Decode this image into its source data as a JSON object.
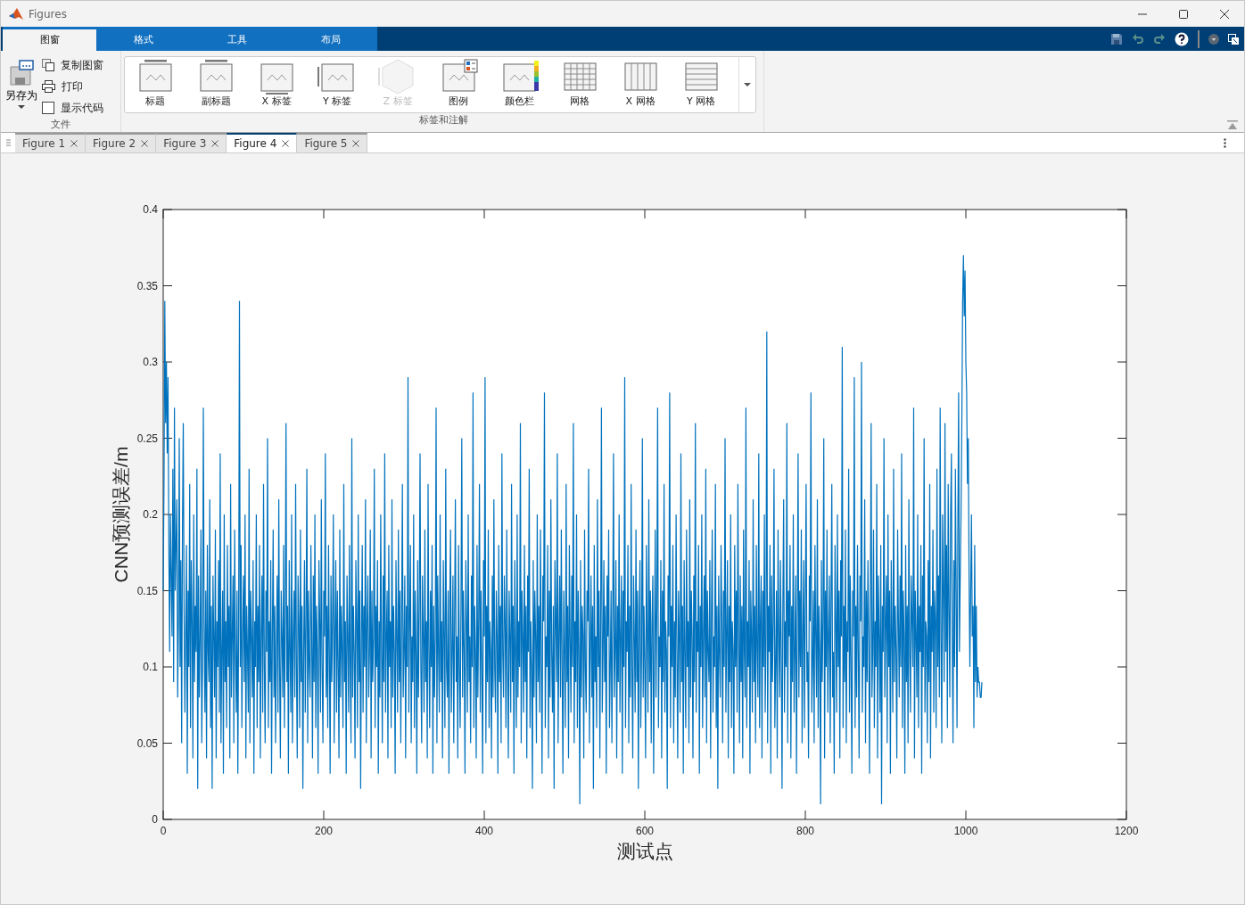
{
  "window": {
    "title": "Figures"
  },
  "ribbon_tabs": [
    {
      "label": "图窗",
      "selected": true
    },
    {
      "label": "格式",
      "selected": false
    },
    {
      "label": "工具",
      "selected": false
    },
    {
      "label": "布局",
      "selected": false
    }
  ],
  "file_section": {
    "label": "文件",
    "save_as": "另存为",
    "copy": "复制图窗",
    "print": "打印",
    "show_code": {
      "label": "显示代码",
      "checked": false
    }
  },
  "annotations_section": {
    "label": "标签和注解",
    "items": [
      {
        "kind": "title",
        "label": "标题",
        "disabled": false
      },
      {
        "kind": "subtitle",
        "label": "副标题",
        "disabled": false
      },
      {
        "kind": "xlabel",
        "label": "X 标签",
        "disabled": false
      },
      {
        "kind": "ylabel",
        "label": "Y 标签",
        "disabled": false
      },
      {
        "kind": "zlabel",
        "label": "Z 标签",
        "disabled": true
      },
      {
        "kind": "legend",
        "label": "图例",
        "disabled": false
      },
      {
        "kind": "colorbar",
        "label": "颜色栏",
        "disabled": false
      },
      {
        "kind": "grid",
        "label": "网格",
        "disabled": false
      },
      {
        "kind": "xgrid",
        "label": "X 网格",
        "disabled": false
      },
      {
        "kind": "ygrid",
        "label": "Y 网格",
        "disabled": false
      }
    ]
  },
  "figure_tabs": [
    {
      "label": "Figure 1",
      "selected": false
    },
    {
      "label": "Figure 2",
      "selected": false
    },
    {
      "label": "Figure 3",
      "selected": false
    },
    {
      "label": "Figure 4",
      "selected": true
    },
    {
      "label": "Figure 5",
      "selected": false
    }
  ],
  "plot": {
    "chart_data": {
      "type": "line",
      "xlabel": "测试点",
      "ylabel": "CNN预测误差/m",
      "xlim": [
        0,
        1200
      ],
      "ylim": [
        0,
        0.4
      ],
      "xticks": [
        0,
        200,
        400,
        600,
        800,
        1000,
        1200
      ],
      "yticks": [
        0,
        0.05,
        0.1,
        0.15,
        0.2,
        0.25,
        0.3,
        0.35,
        0.4
      ],
      "x": [
        0,
        1,
        2,
        3,
        4,
        5,
        6,
        7,
        8,
        9,
        10,
        11,
        12,
        13,
        14,
        15,
        16,
        17,
        18,
        19,
        20,
        21,
        22,
        23,
        24,
        25,
        26,
        27,
        28,
        29,
        30,
        31,
        32,
        33,
        34,
        35,
        36,
        37,
        38,
        39,
        40,
        41,
        42,
        43,
        44,
        45,
        46,
        47,
        48,
        49,
        50,
        51,
        52,
        53,
        54,
        55,
        56,
        57,
        58,
        59,
        60,
        61,
        62,
        63,
        64,
        65,
        66,
        67,
        68,
        69,
        70,
        71,
        72,
        73,
        74,
        75,
        76,
        77,
        78,
        79,
        80,
        81,
        82,
        83,
        84,
        85,
        86,
        87,
        88,
        89,
        90,
        91,
        92,
        93,
        94,
        95,
        96,
        97,
        98,
        99,
        100,
        101,
        102,
        103,
        104,
        105,
        106,
        107,
        108,
        109,
        110,
        111,
        112,
        113,
        114,
        115,
        116,
        117,
        118,
        119,
        120,
        121,
        122,
        123,
        124,
        125,
        126,
        127,
        128,
        129,
        130,
        131,
        132,
        133,
        134,
        135,
        136,
        137,
        138,
        139,
        140,
        141,
        142,
        143,
        144,
        145,
        146,
        147,
        148,
        149,
        150,
        151,
        152,
        153,
        154,
        155,
        156,
        157,
        158,
        159,
        160,
        161,
        162,
        163,
        164,
        165,
        166,
        167,
        168,
        169,
        170,
        171,
        172,
        173,
        174,
        175,
        176,
        177,
        178,
        179,
        180,
        181,
        182,
        183,
        184,
        185,
        186,
        187,
        188,
        189,
        190,
        191,
        192,
        193,
        194,
        195,
        196,
        197,
        198,
        199,
        200,
        201,
        202,
        203,
        204,
        205,
        206,
        207,
        208,
        209,
        210,
        211,
        212,
        213,
        214,
        215,
        216,
        217,
        218,
        219,
        220,
        221,
        222,
        223,
        224,
        225,
        226,
        227,
        228,
        229,
        230,
        231,
        232,
        233,
        234,
        235,
        236,
        237,
        238,
        239,
        240,
        241,
        242,
        243,
        244,
        245,
        246,
        247,
        248,
        249,
        250,
        251,
        252,
        253,
        254,
        255,
        256,
        257,
        258,
        259,
        260,
        261,
        262,
        263,
        264,
        265,
        266,
        267,
        268,
        269,
        270,
        271,
        272,
        273,
        274,
        275,
        276,
        277,
        278,
        279,
        280,
        281,
        282,
        283,
        284,
        285,
        286,
        287,
        288,
        289,
        290,
        291,
        292,
        293,
        294,
        295,
        296,
        297,
        298,
        299,
        300,
        301,
        302,
        303,
        304,
        305,
        306,
        307,
        308,
        309,
        310,
        311,
        312,
        313,
        314,
        315,
        316,
        317,
        318,
        319,
        320,
        321,
        322,
        323,
        324,
        325,
        326,
        327,
        328,
        329,
        330,
        331,
        332,
        333,
        334,
        335,
        336,
        337,
        338,
        339,
        340,
        341,
        342,
        343,
        344,
        345,
        346,
        347,
        348,
        349,
        350,
        351,
        352,
        353,
        354,
        355,
        356,
        357,
        358,
        359,
        360,
        361,
        362,
        363,
        364,
        365,
        366,
        367,
        368,
        369,
        370,
        371,
        372,
        373,
        374,
        375,
        376,
        377,
        378,
        379,
        380,
        381,
        382,
        383,
        384,
        385,
        386,
        387,
        388,
        389,
        390,
        391,
        392,
        393,
        394,
        395,
        396,
        397,
        398,
        399,
        400,
        401,
        402,
        403,
        404,
        405,
        406,
        407,
        408,
        409,
        410,
        411,
        412,
        413,
        414,
        415,
        416,
        417,
        418,
        419,
        420,
        421,
        422,
        423,
        424,
        425,
        426,
        427,
        428,
        429,
        430,
        431,
        432,
        433,
        434,
        435,
        436,
        437,
        438,
        439,
        440,
        441,
        442,
        443,
        444,
        445,
        446,
        447,
        448,
        449,
        450,
        451,
        452,
        453,
        454,
        455,
        456,
        457,
        458,
        459,
        460,
        461,
        462,
        463,
        464,
        465,
        466,
        467,
        468,
        469,
        470,
        471,
        472,
        473,
        474,
        475,
        476,
        477,
        478,
        479,
        480,
        481,
        482,
        483,
        484,
        485,
        486,
        487,
        488,
        489,
        490,
        491,
        492,
        493,
        494,
        495,
        496,
        497,
        498,
        499,
        500,
        501,
        502,
        503,
        504,
        505,
        506,
        507,
        508,
        509,
        510,
        511,
        512,
        513,
        514,
        515,
        516,
        517,
        518,
        519,
        520,
        521,
        522,
        523,
        524,
        525,
        526,
        527,
        528,
        529,
        530,
        531,
        532,
        533,
        534,
        535,
        536,
        537,
        538,
        539,
        540,
        541,
        542,
        543,
        544,
        545,
        546,
        547,
        548,
        549,
        550,
        551,
        552,
        553,
        554,
        555,
        556,
        557,
        558,
        559,
        560,
        561,
        562,
        563,
        564,
        565,
        566,
        567,
        568,
        569,
        570,
        571,
        572,
        573,
        574,
        575,
        576,
        577,
        578,
        579,
        580,
        581,
        582,
        583,
        584,
        585,
        586,
        587,
        588,
        589,
        590,
        591,
        592,
        593,
        594,
        595,
        596,
        597,
        598,
        599,
        600,
        601,
        602,
        603,
        604,
        605,
        606,
        607,
        608,
        609,
        610,
        611,
        612,
        613,
        614,
        615,
        616,
        617,
        618,
        619,
        620,
        621,
        622,
        623,
        624,
        625,
        626,
        627,
        628,
        629,
        630,
        631,
        632,
        633,
        634,
        635,
        636,
        637,
        638,
        639,
        640,
        641,
        642,
        643,
        644,
        645,
        646,
        647,
        648,
        649,
        650,
        651,
        652,
        653,
        654,
        655,
        656,
        657,
        658,
        659,
        660,
        661,
        662,
        663,
        664,
        665,
        666,
        667,
        668,
        669,
        670,
        671,
        672,
        673,
        674,
        675,
        676,
        677,
        678,
        679,
        680,
        681,
        682,
        683,
        684,
        685,
        686,
        687,
        688,
        689,
        690,
        691,
        692,
        693,
        694,
        695,
        696,
        697,
        698,
        699,
        700,
        701,
        702,
        703,
        704,
        705,
        706,
        707,
        708,
        709,
        710,
        711,
        712,
        713,
        714,
        715,
        716,
        717,
        718,
        719,
        720,
        721,
        722,
        723,
        724,
        725,
        726,
        727,
        728,
        729,
        730,
        731,
        732,
        733,
        734,
        735,
        736,
        737,
        738,
        739,
        740,
        741,
        742,
        743,
        744,
        745,
        746,
        747,
        748,
        749,
        750,
        751,
        752,
        753,
        754,
        755,
        756,
        757,
        758,
        759,
        760,
        761,
        762,
        763,
        764,
        765,
        766,
        767,
        768,
        769,
        770,
        771,
        772,
        773,
        774,
        775,
        776,
        777,
        778,
        779,
        780,
        781,
        782,
        783,
        784,
        785,
        786,
        787,
        788,
        789,
        790,
        791,
        792,
        793,
        794,
        795,
        796,
        797,
        798,
        799,
        800,
        801,
        802,
        803,
        804,
        805,
        806,
        807,
        808,
        809,
        810,
        811,
        812,
        813,
        814,
        815,
        816,
        817,
        818,
        819,
        820,
        821,
        822,
        823,
        824,
        825,
        826,
        827,
        828,
        829,
        830,
        831,
        832,
        833,
        834,
        835,
        836,
        837,
        838,
        839,
        840,
        841,
        842,
        843,
        844,
        845,
        846,
        847,
        848,
        849,
        850,
        851,
        852,
        853,
        854,
        855,
        856,
        857,
        858,
        859,
        860,
        861,
        862,
        863,
        864,
        865,
        866,
        867,
        868,
        869,
        870,
        871,
        872,
        873,
        874,
        875,
        876,
        877,
        878,
        879,
        880,
        881,
        882,
        883,
        884,
        885,
        886,
        887,
        888,
        889,
        890,
        891,
        892,
        893,
        894,
        895,
        896,
        897,
        898,
        899,
        900,
        901,
        902,
        903,
        904,
        905,
        906,
        907,
        908,
        909,
        910,
        911,
        912,
        913,
        914,
        915,
        916,
        917,
        918,
        919,
        920,
        921,
        922,
        923,
        924,
        925,
        926,
        927,
        928,
        929,
        930,
        931,
        932,
        933,
        934,
        935,
        936,
        937,
        938,
        939,
        940,
        941,
        942,
        943,
        944,
        945,
        946,
        947,
        948,
        949,
        950,
        951,
        952,
        953,
        954,
        955,
        956,
        957,
        958,
        959,
        960,
        961,
        962,
        963,
        964,
        965,
        966,
        967,
        968,
        969,
        970,
        971,
        972,
        973,
        974,
        975,
        976,
        977,
        978,
        979,
        980,
        981,
        982,
        983,
        984,
        985,
        986,
        987,
        988,
        989,
        990,
        991,
        992,
        993,
        994,
        995,
        996,
        997,
        998,
        999,
        1000,
        1001,
        1002,
        1003,
        1004,
        1005,
        1006,
        1007,
        1008,
        1009,
        1010,
        1011,
        1012,
        1013,
        1014,
        1015,
        1016,
        1017,
        1018,
        1019,
        1020
      ],
      "values": [
        0.15,
        0.22,
        0.34,
        0.26,
        0.3,
        0.24,
        0.29,
        0.18,
        0.11,
        0.2,
        0.16,
        0.12,
        0.23,
        0.09,
        0.27,
        0.15,
        0.18,
        0.21,
        0.08,
        0.13,
        0.25,
        0.1,
        0.17,
        0.05,
        0.19,
        0.26,
        0.14,
        0.07,
        0.12,
        0.18,
        0.03,
        0.15,
        0.1,
        0.22,
        0.06,
        0.17,
        0.13,
        0.04,
        0.2,
        0.09,
        0.14,
        0.11,
        0.23,
        0.02,
        0.16,
        0.08,
        0.12,
        0.19,
        0.05,
        0.1,
        0.27,
        0.13,
        0.07,
        0.15,
        0.04,
        0.18,
        0.11,
        0.09,
        0.21,
        0.06,
        0.14,
        0.02,
        0.16,
        0.12,
        0.08,
        0.19,
        0.04,
        0.13,
        0.1,
        0.17,
        0.07,
        0.24,
        0.05,
        0.11,
        0.15,
        0.03,
        0.2,
        0.09,
        0.13,
        0.06,
        0.18,
        0.1,
        0.14,
        0.04,
        0.22,
        0.08,
        0.12,
        0.16,
        0.05,
        0.19,
        0.11,
        0.07,
        0.15,
        0.03,
        0.13,
        0.34,
        0.1,
        0.18,
        0.06,
        0.12,
        0.16,
        0.09,
        0.2,
        0.04,
        0.14,
        0.11,
        0.07,
        0.23,
        0.05,
        0.15,
        0.12,
        0.08,
        0.17,
        0.03,
        0.13,
        0.1,
        0.2,
        0.06,
        0.14,
        0.09,
        0.18,
        0.04,
        0.12,
        0.16,
        0.07,
        0.22,
        0.1,
        0.05,
        0.15,
        0.11,
        0.25,
        0.06,
        0.13,
        0.09,
        0.17,
        0.03,
        0.12,
        0.19,
        0.08,
        0.14,
        0.05,
        0.11,
        0.16,
        0.07,
        0.21,
        0.1,
        0.04,
        0.15,
        0.12,
        0.08,
        0.18,
        0.06,
        0.13,
        0.26,
        0.09,
        0.14,
        0.03,
        0.17,
        0.11,
        0.07,
        0.2,
        0.05,
        0.12,
        0.15,
        0.08,
        0.22,
        0.1,
        0.04,
        0.16,
        0.13,
        0.06,
        0.19,
        0.09,
        0.14,
        0.02,
        0.11,
        0.17,
        0.07,
        0.13,
        0.23,
        0.05,
        0.15,
        0.1,
        0.08,
        0.18,
        0.12,
        0.04,
        0.16,
        0.09,
        0.2,
        0.06,
        0.14,
        0.11,
        0.03,
        0.17,
        0.13,
        0.07,
        0.21,
        0.1,
        0.05,
        0.15,
        0.12,
        0.24,
        0.08,
        0.14,
        0.06,
        0.18,
        0.11,
        0.03,
        0.16,
        0.09,
        0.13,
        0.2,
        0.05,
        0.12,
        0.17,
        0.07,
        0.15,
        0.1,
        0.04,
        0.19,
        0.08,
        0.14,
        0.11,
        0.06,
        0.22,
        0.09,
        0.13,
        0.03,
        0.16,
        0.12,
        0.07,
        0.18,
        0.1,
        0.05,
        0.25,
        0.08,
        0.14,
        0.11,
        0.04,
        0.17,
        0.13,
        0.06,
        0.2,
        0.09,
        0.15,
        0.02,
        0.12,
        0.18,
        0.07,
        0.14,
        0.1,
        0.21,
        0.05,
        0.13,
        0.16,
        0.08,
        0.11,
        0.19,
        0.04,
        0.15,
        0.09,
        0.12,
        0.23,
        0.06,
        0.14,
        0.1,
        0.17,
        0.03,
        0.13,
        0.08,
        0.2,
        0.11,
        0.05,
        0.16,
        0.09,
        0.24,
        0.07,
        0.12,
        0.15,
        0.04,
        0.18,
        0.1,
        0.13,
        0.06,
        0.21,
        0.08,
        0.14,
        0.11,
        0.03,
        0.17,
        0.12,
        0.07,
        0.19,
        0.09,
        0.15,
        0.05,
        0.13,
        0.22,
        0.08,
        0.11,
        0.16,
        0.04,
        0.14,
        0.1,
        0.29,
        0.07,
        0.13,
        0.18,
        0.05,
        0.12,
        0.09,
        0.2,
        0.06,
        0.15,
        0.11,
        0.03,
        0.17,
        0.08,
        0.14,
        0.24,
        0.1,
        0.05,
        0.16,
        0.12,
        0.07,
        0.19,
        0.09,
        0.13,
        0.04,
        0.22,
        0.11,
        0.06,
        0.15,
        0.1,
        0.18,
        0.03,
        0.14,
        0.08,
        0.12,
        0.27,
        0.05,
        0.16,
        0.11,
        0.07,
        0.2,
        0.09,
        0.13,
        0.04,
        0.17,
        0.12,
        0.06,
        0.23,
        0.1,
        0.08,
        0.15,
        0.03,
        0.14,
        0.19,
        0.07,
        0.11,
        0.16,
        0.05,
        0.13,
        0.21,
        0.09,
        0.12,
        0.04,
        0.18,
        0.1,
        0.06,
        0.14,
        0.25,
        0.08,
        0.15,
        0.11,
        0.03,
        0.17,
        0.13,
        0.07,
        0.2,
        0.09,
        0.12,
        0.05,
        0.16,
        0.1,
        0.28,
        0.06,
        0.14,
        0.11,
        0.04,
        0.18,
        0.08,
        0.13,
        0.22,
        0.07,
        0.15,
        0.1,
        0.03,
        0.17,
        0.12,
        0.29,
        0.05,
        0.14,
        0.09,
        0.19,
        0.06,
        0.13,
        0.11,
        0.04,
        0.16,
        0.08,
        0.21,
        0.1,
        0.07,
        0.15,
        0.12,
        0.03,
        0.18,
        0.09,
        0.14,
        0.05,
        0.24,
        0.11,
        0.08,
        0.16,
        0.13,
        0.06,
        0.19,
        0.1,
        0.04,
        0.15,
        0.12,
        0.07,
        0.22,
        0.09,
        0.14,
        0.03,
        0.17,
        0.11,
        0.06,
        0.2,
        0.08,
        0.13,
        0.1,
        0.26,
        0.05,
        0.15,
        0.12,
        0.07,
        0.18,
        0.09,
        0.14,
        0.04,
        0.16,
        0.11,
        0.23,
        0.06,
        0.13,
        0.1,
        0.02,
        0.17,
        0.08,
        0.15,
        0.12,
        0.05,
        0.2,
        0.09,
        0.14,
        0.07,
        0.19,
        0.11,
        0.03,
        0.16,
        0.13,
        0.28,
        0.06,
        0.12,
        0.1,
        0.18,
        0.04,
        0.15,
        0.08,
        0.21,
        0.11,
        0.07,
        0.14,
        0.02,
        0.17,
        0.13,
        0.09,
        0.24,
        0.05,
        0.12,
        0.16,
        0.08,
        0.19,
        0.1,
        0.03,
        0.15,
        0.11,
        0.06,
        0.22,
        0.09,
        0.14,
        0.04,
        0.18,
        0.12,
        0.07,
        0.16,
        0.1,
        0.26,
        0.05,
        0.13,
        0.09,
        0.2,
        0.06,
        0.15,
        0.11,
        0.01,
        0.17,
        0.08,
        0.14,
        0.12,
        0.04,
        0.19,
        0.1,
        0.07,
        0.15,
        0.13,
        0.23,
        0.05,
        0.11,
        0.16,
        0.08,
        0.14,
        0.02,
        0.18,
        0.09,
        0.12,
        0.06,
        0.21,
        0.1,
        0.15,
        0.04,
        0.13,
        0.27,
        0.07,
        0.11,
        0.17,
        0.09,
        0.14,
        0.03,
        0.16,
        0.12,
        0.19,
        0.06,
        0.1,
        0.15,
        0.05,
        0.13,
        0.24,
        0.08,
        0.11,
        0.17,
        0.04,
        0.14,
        0.09,
        0.2,
        0.07,
        0.12,
        0.16,
        0.03,
        0.15,
        0.1,
        0.29,
        0.06,
        0.13,
        0.11,
        0.18,
        0.05,
        0.14,
        0.08,
        0.22,
        0.1,
        0.04,
        0.16,
        0.12,
        0.07,
        0.19,
        0.09,
        0.15,
        0.02,
        0.13,
        0.17,
        0.06,
        0.11,
        0.25,
        0.08,
        0.14,
        0.1,
        0.04,
        0.18,
        0.12,
        0.07,
        0.21,
        0.09,
        0.15,
        0.05,
        0.13,
        0.16,
        0.03,
        0.11,
        0.19,
        0.08,
        0.14,
        0.27,
        0.06,
        0.12,
        0.1,
        0.17,
        0.04,
        0.15,
        0.09,
        0.22,
        0.07,
        0.13,
        0.11,
        0.02,
        0.16,
        0.12,
        0.28,
        0.06,
        0.14,
        0.1,
        0.18,
        0.05,
        0.13,
        0.08,
        0.2,
        0.11,
        0.04,
        0.15,
        0.12,
        0.07,
        0.24,
        0.09,
        0.14,
        0.03,
        0.17,
        0.11,
        0.06,
        0.19,
        0.1,
        0.13,
        0.05,
        0.21,
        0.08,
        0.15,
        0.12,
        0.04,
        0.16,
        0.09,
        0.26,
        0.07,
        0.13,
        0.11,
        0.18,
        0.03,
        0.14,
        0.1,
        0.2,
        0.06,
        0.12,
        0.16,
        0.08,
        0.23,
        0.05,
        0.15,
        0.11,
        0.09,
        0.17,
        0.04,
        0.13,
        0.19,
        0.07,
        0.12,
        0.1,
        0.22,
        0.06,
        0.14,
        0.02,
        0.16,
        0.11,
        0.08,
        0.18,
        0.13,
        0.05,
        0.15,
        0.1,
        0.25,
        0.07,
        0.12,
        0.17,
        0.04,
        0.14,
        0.09,
        0.2,
        0.06,
        0.13,
        0.11,
        0.03,
        0.18,
        0.1,
        0.15,
        0.07,
        0.22,
        0.12,
        0.05,
        0.16,
        0.09,
        0.14,
        0.04,
        0.19,
        0.11,
        0.08,
        0.27,
        0.06,
        0.13,
        0.1,
        0.17,
        0.03,
        0.15,
        0.12,
        0.07,
        0.21,
        0.09,
        0.14,
        0.05,
        0.18,
        0.11,
        0.08,
        0.24,
        0.06,
        0.13,
        0.16,
        0.04,
        0.15,
        0.1,
        0.2,
        0.07,
        0.12,
        0.32,
        0.05,
        0.14,
        0.11,
        0.18,
        0.03,
        0.16,
        0.09,
        0.13,
        0.23,
        0.06,
        0.1,
        0.15,
        0.04,
        0.19,
        0.12,
        0.08,
        0.17,
        0.11,
        0.02,
        0.14,
        0.21,
        0.07,
        0.13,
        0.1,
        0.26,
        0.05,
        0.15,
        0.12,
        0.18,
        0.04,
        0.14,
        0.09,
        0.2,
        0.07,
        0.11,
        0.16,
        0.03,
        0.13,
        0.24,
        0.08,
        0.15,
        0.1,
        0.19,
        0.05,
        0.12,
        0.17,
        0.06,
        0.14,
        0.22,
        0.09,
        0.11,
        0.04,
        0.16,
        0.13,
        0.28,
        0.07,
        0.1,
        0.15,
        0.05,
        0.18,
        0.12,
        0.08,
        0.21,
        0.06,
        0.14,
        0.11,
        0.01,
        0.17,
        0.09,
        0.13,
        0.25,
        0.04,
        0.15,
        0.1,
        0.19,
        0.07,
        0.12,
        0.16,
        0.05,
        0.14,
        0.22,
        0.08,
        0.11,
        0.03,
        0.18,
        0.13,
        0.07,
        0.2,
        0.1,
        0.15,
        0.04,
        0.17,
        0.12,
        0.31,
        0.06,
        0.14,
        0.09,
        0.19,
        0.05,
        0.13,
        0.11,
        0.23,
        0.07,
        0.16,
        0.1,
        0.03,
        0.15,
        0.12,
        0.29,
        0.06,
        0.14,
        0.08,
        0.18,
        0.11,
        0.04,
        0.16,
        0.13,
        0.3,
        0.07,
        0.12,
        0.1,
        0.21,
        0.05,
        0.15,
        0.09,
        0.17,
        0.12,
        0.03,
        0.14,
        0.26,
        0.08,
        0.11,
        0.19,
        0.06,
        0.13,
        0.1,
        0.22,
        0.04,
        0.16,
        0.12,
        0.07,
        0.18,
        0.01,
        0.14,
        0.11,
        0.25,
        0.08,
        0.13,
        0.16,
        0.05,
        0.2,
        0.1,
        0.15,
        0.03,
        0.17,
        0.12,
        0.07,
        0.23,
        0.09,
        0.14,
        0.11,
        0.04,
        0.19,
        0.13,
        0.08,
        0.16,
        0.1,
        0.24,
        0.06,
        0.15,
        0.12,
        0.03,
        0.18,
        0.09,
        0.14,
        0.05,
        0.21,
        0.11,
        0.07,
        0.16,
        0.13,
        0.1,
        0.27,
        0.04,
        0.15,
        0.12,
        0.08,
        0.2,
        0.06,
        0.14,
        0.11,
        0.18,
        0.03,
        0.16,
        0.1,
        0.25,
        0.07,
        0.13,
        0.12,
        0.05,
        0.17,
        0.09,
        0.22,
        0.04,
        0.14,
        0.11,
        0.19,
        0.07,
        0.15,
        0.13,
        0.06,
        0.23,
        0.1,
        0.16,
        0.08,
        0.27,
        0.12,
        0.05,
        0.2,
        0.15,
        0.09,
        0.26,
        0.11,
        0.18,
        0.06,
        0.22,
        0.14,
        0.08,
        0.2,
        0.24,
        0.12,
        0.05,
        0.17,
        0.1,
        0.23,
        0.15,
        0.06,
        0.19,
        0.28,
        0.11,
        0.16,
        0.2,
        0.26,
        0.34,
        0.37,
        0.33,
        0.36,
        0.3,
        0.28,
        0.22,
        0.25,
        0.16,
        0.1,
        0.15,
        0.2,
        0.12,
        0.14,
        0.06,
        0.18,
        0.09,
        0.14,
        0.08,
        0.1,
        0.09,
        0.09,
        0.08,
        0.08,
        0.09
      ]
    }
  }
}
